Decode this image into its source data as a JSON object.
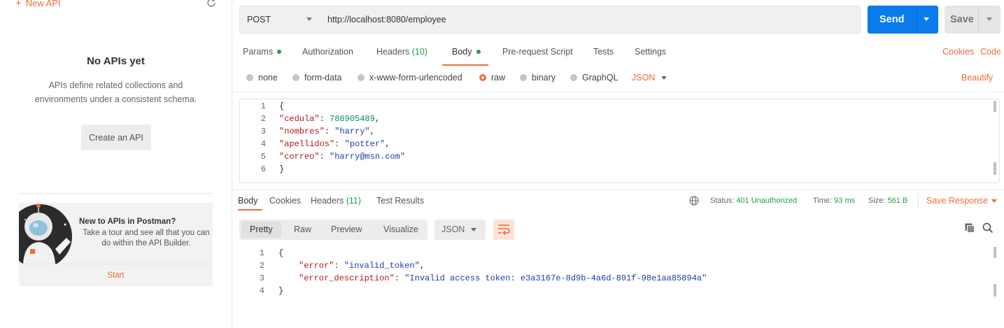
{
  "sidebar": {
    "new_api_label": "New API",
    "empty_title": "No APIs yet",
    "empty_description": "APIs define related collections and environments under a consistent schema.",
    "create_button": "Create an API",
    "promo": {
      "title": "New to APIs in Postman?",
      "text": "Take a tour and see all that you can do within the API Builder.",
      "start_link": "Start"
    }
  },
  "request": {
    "method": "POST",
    "url": "http://localhost:8080/employee",
    "send_label": "Send",
    "save_label": "Save",
    "tabs": {
      "params": "Params",
      "authorization": "Authorization",
      "headers": "Headers",
      "headers_count": "(10)",
      "body": "Body",
      "prerequest": "Pre-request Script",
      "tests": "Tests",
      "settings": "Settings"
    },
    "cookies_link": "Cookies",
    "code_link": "Code",
    "body_types": {
      "none": "none",
      "form_data": "form-data",
      "urlencoded": "x-www-form-urlencoded",
      "raw": "raw",
      "binary": "binary",
      "graphql": "GraphQL"
    },
    "raw_format": "JSON",
    "beautify": "Beautify",
    "body_lines": {
      "l1": {
        "num": "1",
        "brace": "{"
      },
      "l2": {
        "num": "2",
        "key": "\"cedula\"",
        "sep": ": ",
        "val": "788905489",
        "end": ","
      },
      "l3": {
        "num": "3",
        "key": "\"nombres\"",
        "sep": ": ",
        "val": "\"harry\"",
        "end": ","
      },
      "l4": {
        "num": "4",
        "key": "\"apellidos\"",
        "sep": ": ",
        "val": "\"potter\"",
        "end": ","
      },
      "l5": {
        "num": "5",
        "key": "\"correo\"",
        "sep": ": ",
        "val": "\"harry@msn.com\"",
        "end": ""
      },
      "l6": {
        "num": "6",
        "brace": "}"
      }
    }
  },
  "response": {
    "tabs": {
      "body": "Body",
      "cookies": "Cookies",
      "headers": "Headers",
      "headers_count": "(11)",
      "test_results": "Test Results"
    },
    "status_label": "Status:",
    "status_value": "401 Unauthorized",
    "time_label": "Time:",
    "time_value": "93 ms",
    "size_label": "Size:",
    "size_value": "561 B",
    "save_response": "Save Response",
    "views": {
      "pretty": "Pretty",
      "raw": "Raw",
      "preview": "Preview",
      "visualize": "Visualize"
    },
    "format": "JSON",
    "body_lines": {
      "l1": {
        "num": "1",
        "brace": "{"
      },
      "l2": {
        "num": "2",
        "key": "\"error\"",
        "sep": ": ",
        "val": "\"invalid_token\"",
        "end": ","
      },
      "l3": {
        "num": "3",
        "key": "\"error_description\"",
        "sep": ": ",
        "val": "\"Invalid access token: e3a3167e-8d9b-4a6d-891f-98e1aa85894a\"",
        "end": ""
      },
      "l4": {
        "num": "4",
        "brace": "}"
      }
    }
  },
  "icons": {
    "refresh": "refresh-icon",
    "globe": "globe-icon",
    "wrap": "wrap-lines-icon",
    "copy": "copy-icon",
    "search": "search-icon"
  },
  "colors": {
    "accent": "#f26b3a",
    "send": "#097bed",
    "success": "#1aa34a"
  }
}
